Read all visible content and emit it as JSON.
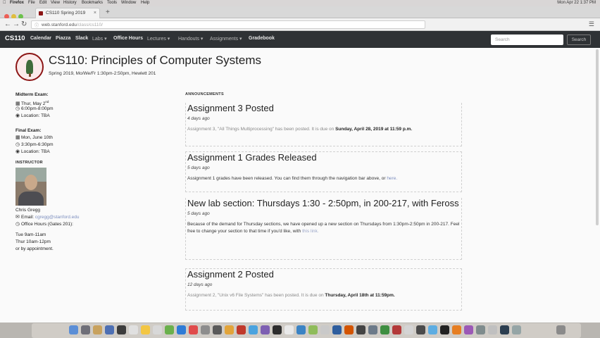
{
  "macbar": {
    "app": "Firefox",
    "menus": [
      "File",
      "Edit",
      "View",
      "History",
      "Bookmarks",
      "Tools",
      "Window",
      "Help"
    ],
    "clock": "Mon Apr 22  1:37 PM"
  },
  "browser": {
    "tab_title": "CS110 Spring 2019",
    "url_host": "web.stanford.edu",
    "url_path": "/class/cs110/"
  },
  "nav": {
    "brand": "CS110",
    "items": [
      "Calendar",
      "Piazza",
      "Slack",
      "Labs ▾",
      "Office Hours",
      "Lectures ▾",
      "Handouts ▾",
      "Assignments ▾",
      "Gradebook"
    ],
    "search_placeholder": "Search",
    "search_button": "Search"
  },
  "header": {
    "title": "CS110: Principles of Computer Systems",
    "subtitle": "Spring 2019, Mo/We/Fr 1:30pm-2:50pm, Hewlett 201"
  },
  "sidebar": {
    "midterm": {
      "heading": "Midterm Exam:",
      "date": "Thur, May 2",
      "date_sup": "nd",
      "time": "6:00pm-8:00pm",
      "location": "Location: TBA"
    },
    "final": {
      "heading": "Final Exam:",
      "date": "Mon, June 10th",
      "time": "3:30pm-6:30pm",
      "location": "Location: TBA"
    },
    "instructor_label": "INSTRUCTOR",
    "instructor_name": "Chris Gregg",
    "email_label": "Email:",
    "email": "cgregg@stanford.edu",
    "office_hours_label": "Office Hours (Gates 201):",
    "hours": [
      "Tue 9am-11am",
      "Thur 10am-12pm",
      "or by appointment."
    ]
  },
  "announcements": {
    "label": "ANNOUNCEMENTS",
    "items": [
      {
        "title": "Assignment 3 Posted",
        "ago": "4 days ago",
        "body_a": "Assignment 3, \"All Things Multiprocessing\" has been posted. It is due on ",
        "body_b": "Sunday, April 28, 2019 at 11:59 p.m."
      },
      {
        "title": "Assignment 1 Grades Released",
        "ago": "5 days ago",
        "body_a": "Assignment 1 grades have been released. You can find them through the navigation bar above, or ",
        "body_b": "here."
      },
      {
        "title": "New lab section: Thursdays 1:30 - 2:50pm, in 200-217, with Feross",
        "ago": "5 days ago",
        "body_a": "Because of the demand for Thursday sections, we have opened up a new section on Thursdays from 1:30pm-2:50pm in 200-217. Feel free to change your section to that time if you'd like, with ",
        "body_b": "this link."
      },
      {
        "title": "Assignment 2 Posted",
        "ago": "12 days ago",
        "body_a": "Assignment 2, \"Unix v6 File Systems\" has been posted. It is due on ",
        "body_b": "Thursday, April 18th at 11:59pm."
      }
    ]
  }
}
